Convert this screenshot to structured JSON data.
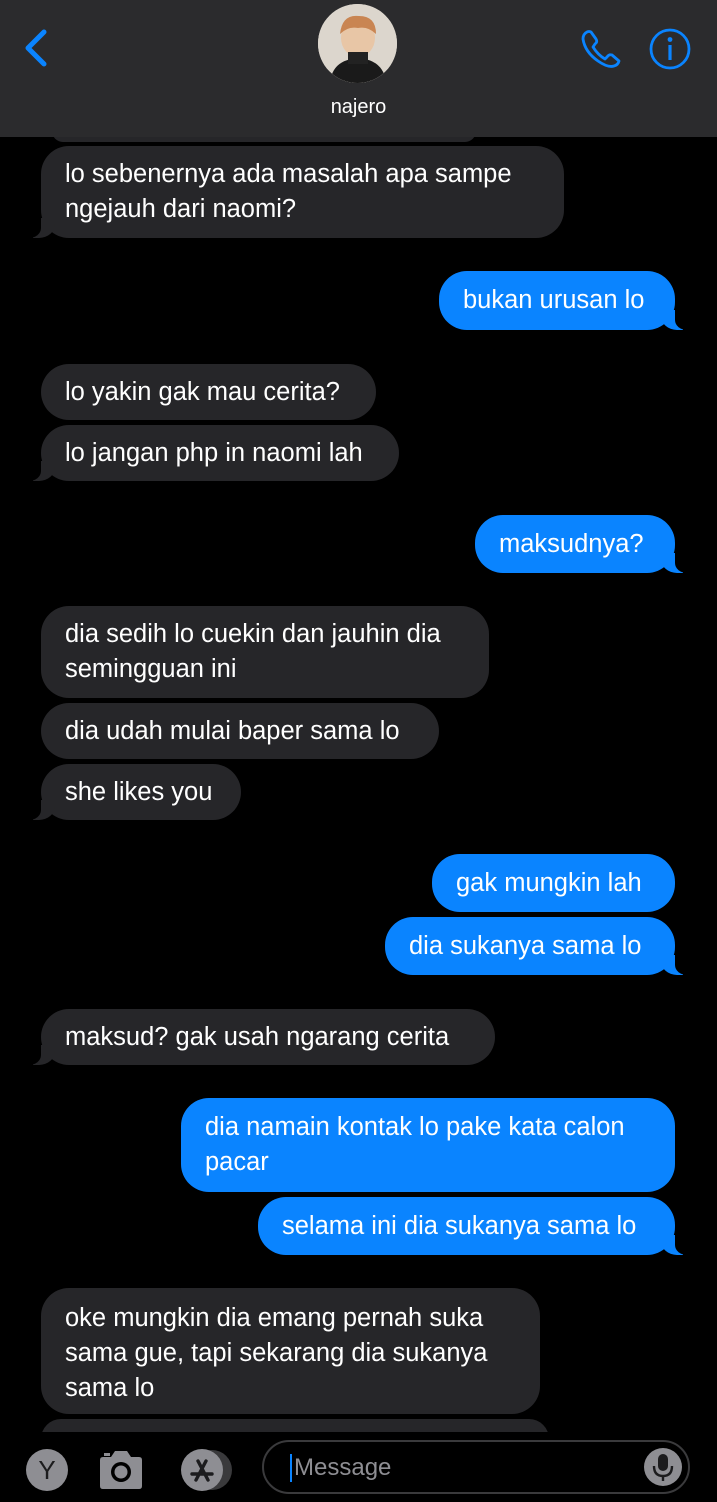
{
  "header": {
    "contact_name": "najero"
  },
  "messages": [
    {
      "dir": "in",
      "lines": [
        "lo sebenernya ada masalah apa sampe",
        "ngejauh dari naomi?"
      ]
    },
    {
      "dir": "out",
      "lines": [
        "bukan urusan lo"
      ]
    },
    {
      "dir": "in",
      "lines": [
        "lo yakin gak mau cerita?"
      ]
    },
    {
      "dir": "in",
      "lines": [
        "lo jangan php in naomi lah"
      ]
    },
    {
      "dir": "out",
      "lines": [
        "maksudnya?"
      ]
    },
    {
      "dir": "in",
      "lines": [
        "dia sedih lo cuekin dan jauhin dia",
        "semingguan ini"
      ]
    },
    {
      "dir": "in",
      "lines": [
        "dia udah mulai baper sama lo"
      ]
    },
    {
      "dir": "in",
      "lines": [
        "she likes you"
      ]
    },
    {
      "dir": "out",
      "lines": [
        "gak mungkin lah"
      ]
    },
    {
      "dir": "out",
      "lines": [
        "dia sukanya sama lo"
      ]
    },
    {
      "dir": "in",
      "lines": [
        "maksud? gak usah ngarang cerita"
      ]
    },
    {
      "dir": "out",
      "lines": [
        "dia namain kontak lo pake kata calon",
        "pacar"
      ]
    },
    {
      "dir": "out",
      "lines": [
        "selama ini dia sukanya sama lo"
      ]
    },
    {
      "dir": "in",
      "lines": [
        "oke mungkin dia emang pernah suka",
        "sama gue, tapi sekarang dia sukanya",
        "sama lo"
      ]
    }
  ],
  "input": {
    "placeholder": "Message",
    "y_button_label": "Y"
  },
  "icons": {
    "back": "chevron-left-icon",
    "call": "phone-icon",
    "info": "info-icon",
    "camera": "camera-icon",
    "appstore": "app-store-icon",
    "mic": "microphone-icon"
  },
  "colors": {
    "accent": "#0a84ff",
    "incoming_bubble": "#262629",
    "header_bg": "#2b2b2d",
    "background": "#000000"
  }
}
